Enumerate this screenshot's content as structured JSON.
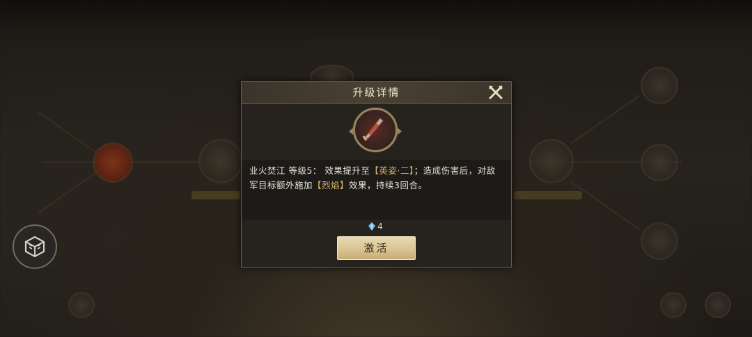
{
  "dialog": {
    "title": "升级详情",
    "skill_icon": "flame-blade-skill-icon",
    "description": {
      "part1": "业火焚江 等级5： 效果提升至",
      "hl1": "【英姿·二】",
      "part2": "；造成伤害后，对敌军目标额外施加",
      "hl2": "【烈焰】",
      "part3": "效果，持续3回合。"
    },
    "cost_value": "4",
    "cost_icon": "blue-gem-icon",
    "activate_label": "激活",
    "close_icon": "close-icon"
  },
  "colors": {
    "highlight": "#d9b46a",
    "button_gold": "#d8c291",
    "panel_bg": "#26231f"
  }
}
